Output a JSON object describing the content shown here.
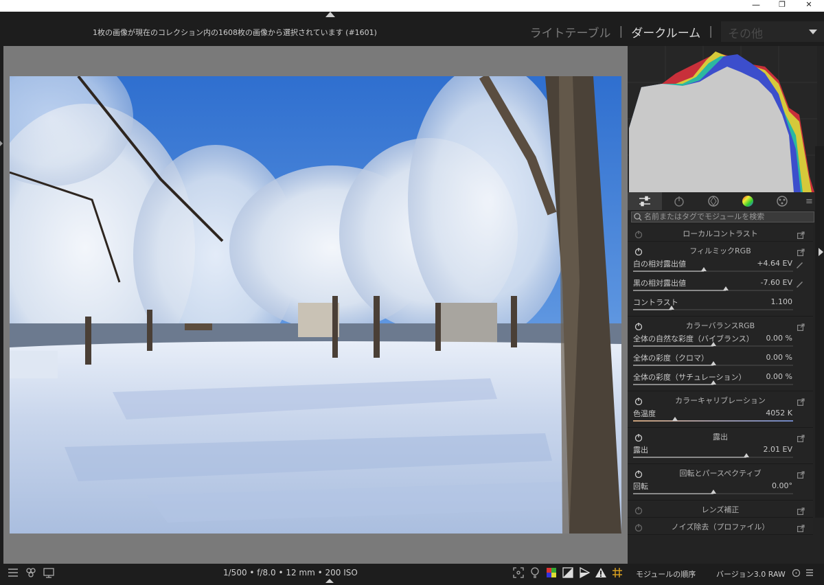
{
  "window": {
    "minimize": "—",
    "restore": "❐",
    "close": "✕"
  },
  "header": {
    "collection_info": "1枚の画像が現在のコレクション内の1608枚の画像から選択されています (#1601)",
    "views": [
      {
        "label": "ライトテーブル"
      },
      {
        "label": "ダークルーム"
      }
    ],
    "separator": "|",
    "other_view": "その他"
  },
  "sidebar": {
    "search_placeholder": "名前またはタグでモジュールを検索",
    "modules": [
      {
        "title": "ローカルコントラスト"
      },
      {
        "title": "フィルミックRGB",
        "sliders": [
          {
            "label": "白の相対露出値",
            "value": "+4.64 EV",
            "pos": 0.44
          },
          {
            "label": "黒の相対露出値",
            "value": "-7.60 EV",
            "pos": 0.58
          },
          {
            "label": "コントラスト",
            "value": "1.100",
            "pos": 0.24
          }
        ]
      },
      {
        "title": "カラーバランスRGB",
        "sliders": [
          {
            "label": "全体の自然な彩度（バイブランス）",
            "value": "0.00 %",
            "pos": 0.5
          },
          {
            "label": "全体の彩度（クロマ）",
            "value": "0.00 %",
            "pos": 0.5
          },
          {
            "label": "全体の彩度（サチュレーション）",
            "value": "0.00 %",
            "pos": 0.5
          }
        ]
      },
      {
        "title": "カラーキャリブレーション",
        "sliders": [
          {
            "label": "色温度",
            "value": "4052 K",
            "pos": 0.26
          }
        ]
      },
      {
        "title": "露出",
        "sliders": [
          {
            "label": "露出",
            "value": "2.01 EV",
            "pos": 0.71
          }
        ]
      },
      {
        "title": "回転とパースペクティブ",
        "sliders": [
          {
            "label": "回転",
            "value": "0.00°",
            "pos": 0.5
          }
        ]
      },
      {
        "title": "レンズ補正"
      },
      {
        "title": "ノイズ除去（プロファイル）"
      }
    ]
  },
  "bottom": {
    "exif": "1/500 • f/8.0 • 12 mm • 200 ISO",
    "module_order": "モジュールの順序",
    "version": "バージョン3.0 RAW"
  },
  "icons": [
    "menu-icon",
    "presets-icon",
    "display-icon",
    "focus-icon",
    "bulb-icon",
    "color-icon",
    "contrast-icon",
    "softproof-icon",
    "warning-icon",
    "grid-icon",
    "power-icon",
    "popout-icon",
    "picker-icon",
    "search-icon"
  ]
}
